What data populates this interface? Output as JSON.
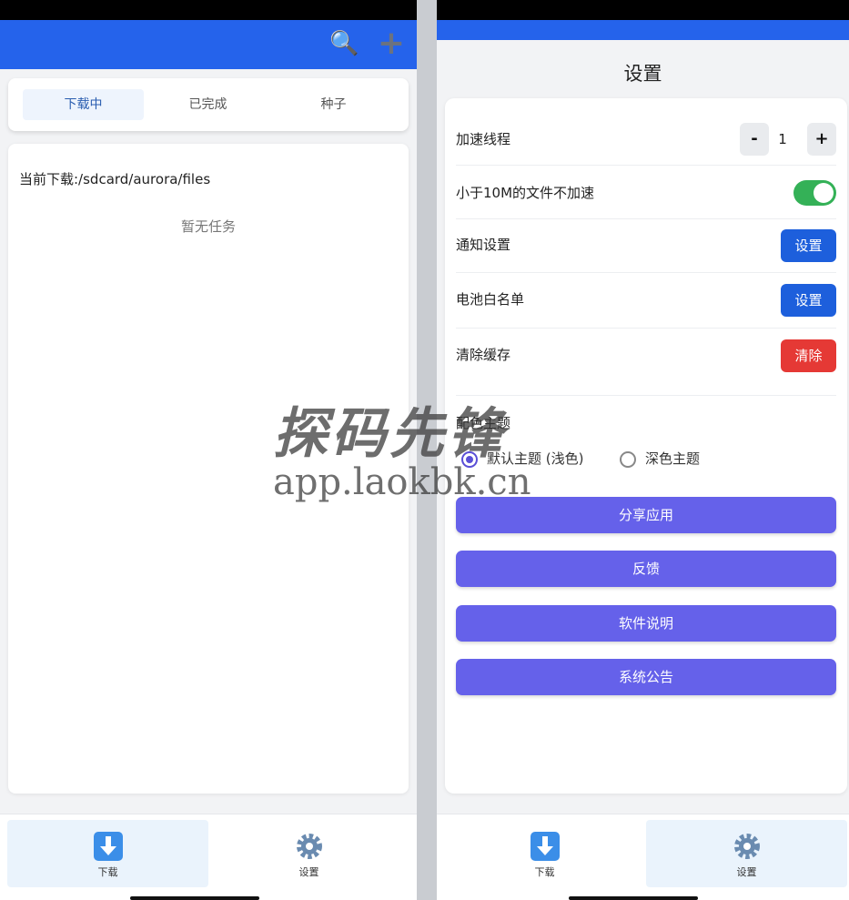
{
  "left": {
    "appbar": {
      "search_icon": "search-icon",
      "add_icon": "plus-icon"
    },
    "tabs": [
      {
        "label": "下载中",
        "active": true
      },
      {
        "label": "已完成",
        "active": false
      },
      {
        "label": "种子",
        "active": false
      }
    ],
    "current_path": "当前下载:/sdcard/aurora/files",
    "empty_text": "暂无任务"
  },
  "right": {
    "title": "设置",
    "threads": {
      "label": "加速线程",
      "minus": "-",
      "value": "1",
      "plus": "+"
    },
    "no_accel_small": {
      "label": "小于10M的文件不加速",
      "enabled": true
    },
    "notification": {
      "label": "通知设置",
      "button": "设置"
    },
    "battery": {
      "label": "电池白名单",
      "button": "设置"
    },
    "cache": {
      "label": "清除缓存",
      "button": "清除"
    },
    "theme": {
      "label": "配色主题",
      "options": [
        {
          "label": "默认主题 (浅色)",
          "selected": true
        },
        {
          "label": "深色主题",
          "selected": false
        }
      ]
    },
    "buttons": [
      "分享应用",
      "反馈",
      "软件说明",
      "系统公告"
    ]
  },
  "nav": {
    "download_label": "下载",
    "settings_label": "设置"
  },
  "watermark": {
    "title": "探码先锋",
    "url": "app.laokbk.cn"
  },
  "colors": {
    "primary": "#2563eb",
    "accent": "#6561ea",
    "toggle_on": "#34b157",
    "danger": "#e53935"
  }
}
